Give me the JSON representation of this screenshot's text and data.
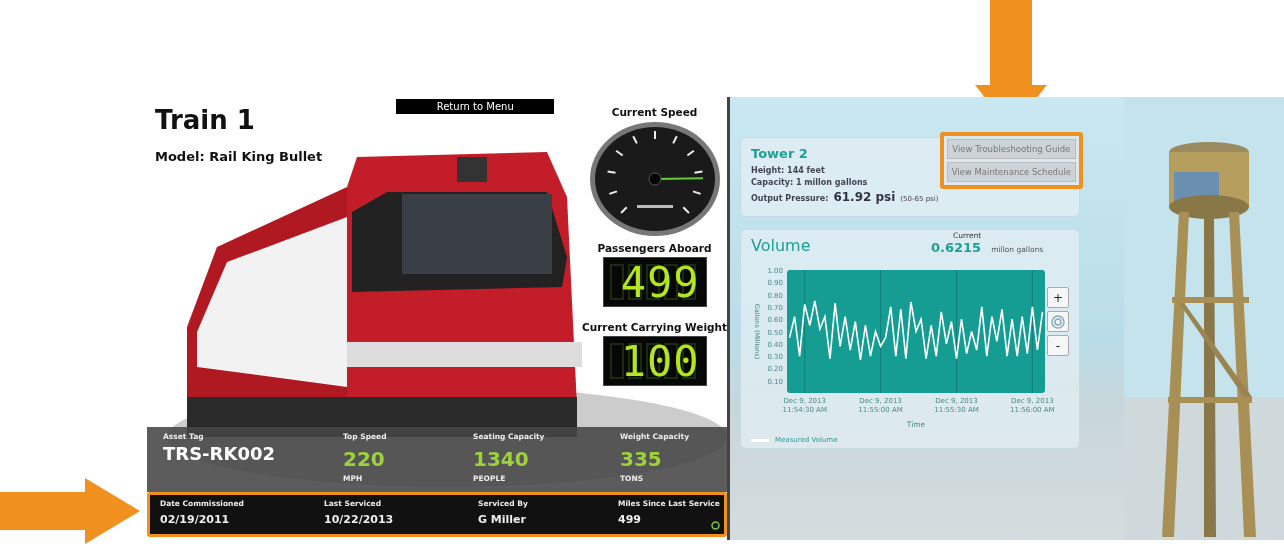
{
  "train_screen": {
    "title": "Train 1",
    "model_label": "Model:",
    "model": "Rail King Bullet",
    "menu_button": "Return to Menu",
    "gauges": [
      {
        "kind": "dial",
        "label": "Current Speed",
        "level": 0.83
      },
      {
        "kind": "digits",
        "label": "Passengers Aboard",
        "value": "499"
      },
      {
        "kind": "digits",
        "label": "Current Carrying Weight",
        "value": "100"
      }
    ],
    "asset": {
      "label": "Asset Tag",
      "value": "TRS-RK002"
    },
    "stats": [
      {
        "label": "Top Speed",
        "value": "220",
        "unit": "MPH"
      },
      {
        "label": "Seating Capacity",
        "value": "1340",
        "unit": "PEOPLE"
      },
      {
        "label": "Weight Capacity",
        "value": "335",
        "unit": "TONS"
      }
    ],
    "service": [
      {
        "label": "Date Commissioned",
        "value": "02/19/2011"
      },
      {
        "label": "Last Serviced",
        "value": "10/22/2013"
      },
      {
        "label": "Serviced By",
        "value": "G Miller"
      },
      {
        "label": "Miles Since Last Service",
        "value": "499"
      }
    ]
  },
  "tower_screen": {
    "title": "Tower 2",
    "facts": [
      {
        "label": "Height:",
        "value": "144 feet"
      },
      {
        "label": "Capacity:",
        "value": "1 millon gallons"
      }
    ],
    "pressure": {
      "label": "Output Pressure:",
      "value": "61.92 psi",
      "range": "(50-65 psi)"
    },
    "buttons": [
      "View Troubleshooting Guide",
      "View Maintenance Schedule"
    ],
    "volume": {
      "title": "Volume",
      "current_label": "Current",
      "current_value": "0.6215",
      "current_unit": "millon gallons",
      "zoom_buttons": [
        "+",
        "-"
      ],
      "chart_data": {
        "type": "line",
        "grid": true,
        "xlabel": "Time",
        "ylabel": "Gallons (Millions)",
        "ylim": [
          0,
          1
        ],
        "categories": [
          null,
          null,
          null,
          "Dec 9, 2013 11:54:30 AM",
          null,
          null,
          null,
          null,
          null,
          null,
          null,
          null,
          null,
          null,
          null,
          null,
          null,
          null,
          "Dec 9, 2013 11:55:00 AM",
          null,
          null,
          null,
          null,
          null,
          null,
          null,
          null,
          null,
          null,
          null,
          null,
          null,
          null,
          "Dec 9, 2013 11:55:30 AM",
          null,
          null,
          null,
          null,
          null,
          null,
          null,
          null,
          null,
          null,
          null,
          null,
          null,
          null,
          "Dec 9, 2013 11:56:00 AM",
          null,
          null
        ],
        "yticks": [
          {
            "value": 0.1,
            "label": "0.10"
          },
          {
            "value": 0.2,
            "label": "0.20"
          },
          {
            "value": 0.3,
            "label": "0.30"
          },
          {
            "value": 0.4,
            "label": "0.40"
          },
          {
            "value": 0.5,
            "label": "0.50"
          },
          {
            "value": 0.6,
            "label": "0.60"
          },
          {
            "value": 0.7,
            "label": "0.70"
          },
          {
            "value": 0.8,
            "label": "0.80"
          },
          {
            "value": 0.9,
            "label": "0.90"
          },
          {
            "value": 1,
            "label": "1.00"
          }
        ],
        "series": [
          {
            "name": "Measured Volume",
            "color": "#ffffff",
            "values": [
              0.45,
              0.62,
              0.3,
              0.72,
              0.55,
              0.75,
              0.52,
              0.62,
              0.28,
              0.73,
              0.38,
              0.62,
              0.35,
              0.58,
              0.27,
              0.55,
              0.3,
              0.5,
              0.38,
              0.45,
              0.7,
              0.3,
              0.68,
              0.28,
              0.74,
              0.5,
              0.6,
              0.28,
              0.55,
              0.3,
              0.66,
              0.4,
              0.58,
              0.28,
              0.6,
              0.32,
              0.5,
              0.35,
              0.7,
              0.3,
              0.62,
              0.42,
              0.68,
              0.3,
              0.6,
              0.3,
              0.62,
              0.32,
              0.7,
              0.35,
              0.66
            ]
          }
        ]
      }
    }
  }
}
